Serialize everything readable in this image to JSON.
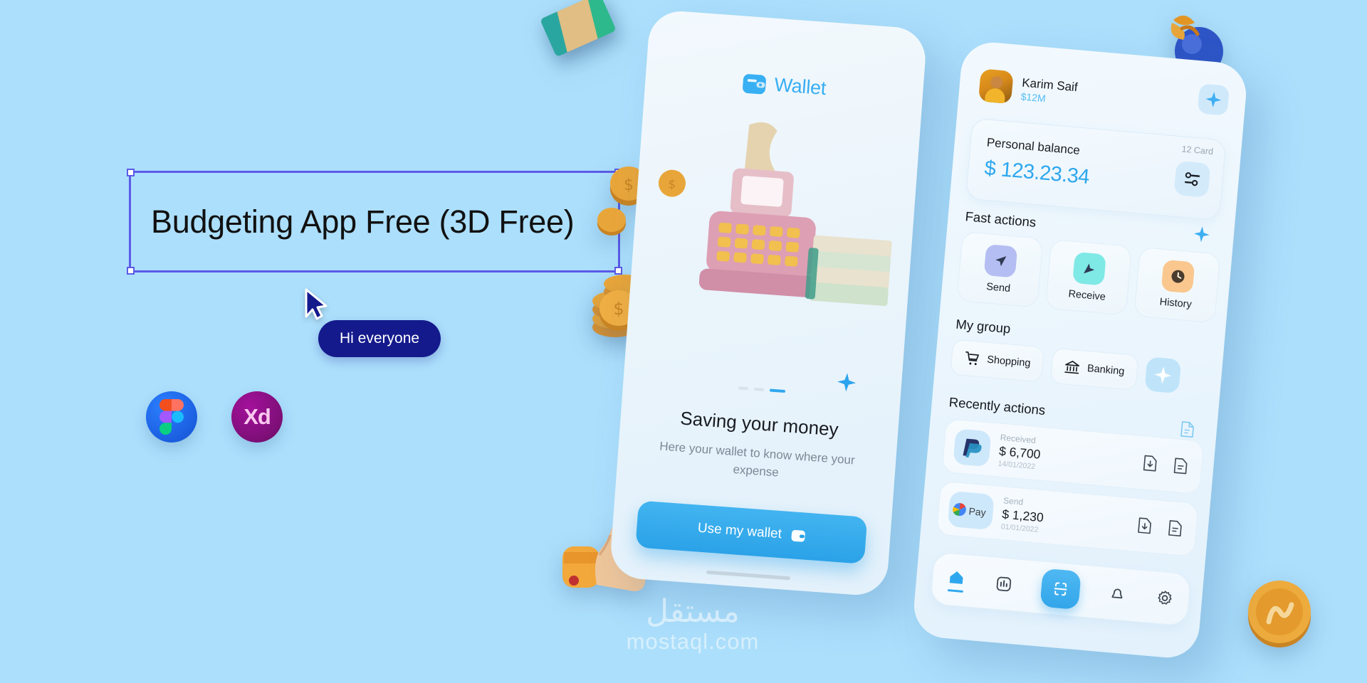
{
  "canvas": {
    "background_color": "#ACDFFC",
    "accent_blue": "#2DA7EE",
    "selection_color": "#5B5BE8"
  },
  "design_file": {
    "selected_text_layer": "Budgeting App Free (3D Free)",
    "cursor_label": "Hi everyone",
    "tools": [
      {
        "name": "figma-logo",
        "label": ""
      },
      {
        "name": "adobe-xd-logo",
        "label": "Xd"
      }
    ]
  },
  "phone_left": {
    "brand": "Wallet",
    "headline": "Saving your money",
    "subtext": "Here your wallet to know where your expense",
    "cta_label": "Use my wallet",
    "pager_dots": 3,
    "pager_active_index": 2
  },
  "phone_right": {
    "user": {
      "name": "Karim Saif",
      "balance_tag": "$12M"
    },
    "balance_card": {
      "label": "Personal balance",
      "amount": "$ 123.23.34",
      "card_count": "12 Card"
    },
    "fast_actions": {
      "title": "Fast actions",
      "items": [
        {
          "label": "Send",
          "icon": "send-icon",
          "color": "#B5BEF2"
        },
        {
          "label": "Receive",
          "icon": "receive-icon",
          "color": "#7FE9E6"
        },
        {
          "label": "History",
          "icon": "clock-icon",
          "color": "#FAC78E"
        }
      ]
    },
    "my_group": {
      "title": "My group",
      "items": [
        {
          "label": "Shopping",
          "icon": "cart-icon"
        },
        {
          "label": "Banking",
          "icon": "bank-icon"
        }
      ],
      "add_icon": "sparkle-icon"
    },
    "recent": {
      "title": "Recently actions",
      "transactions": [
        {
          "provider": "PayPal",
          "provider_icon": "paypal-icon",
          "kind": "Received",
          "amount": "$ 6,700",
          "date": "14/01/2022",
          "actions": [
            "download-icon",
            "receipt-icon"
          ]
        },
        {
          "provider": "G Pay",
          "provider_icon": "gpay-icon",
          "kind": "Send",
          "amount": "$ 1,230",
          "date": "01/01/2022",
          "actions": [
            "download-icon",
            "receipt-icon"
          ]
        }
      ]
    },
    "nav": [
      {
        "name": "home",
        "icon": "home-icon",
        "active": true
      },
      {
        "name": "stats",
        "icon": "bar-chart-icon",
        "active": false
      },
      {
        "name": "scan",
        "icon": "scan-icon",
        "active": false
      },
      {
        "name": "alerts",
        "icon": "bell-icon",
        "active": false
      },
      {
        "name": "settings",
        "icon": "gear-icon",
        "active": false
      }
    ]
  },
  "watermark": {
    "arabic": "مستقل",
    "latin": "mostaql.com"
  }
}
